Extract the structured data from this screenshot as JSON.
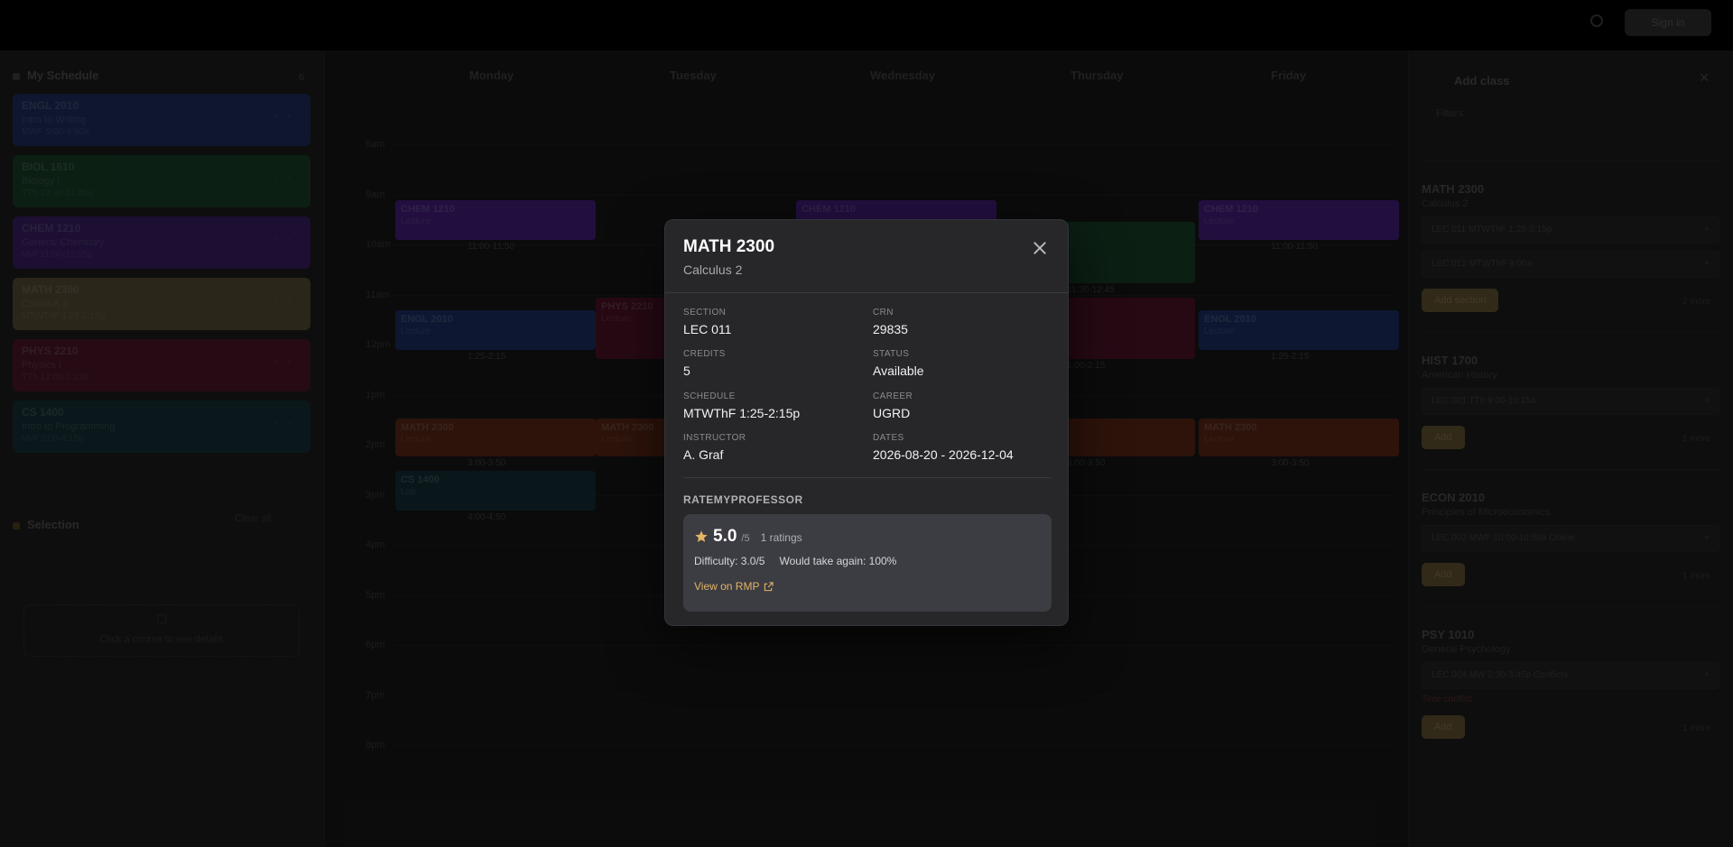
{
  "topbar": {
    "action_label": "Sign in"
  },
  "left_panel": {
    "heading": "My Schedule",
    "count": "6",
    "courses": [
      {
        "code": "ENGL 2010",
        "title": "Intro to Writing",
        "meta": "MWF 9:00-9:50a",
        "color": "#1f3a8a"
      },
      {
        "code": "BIOL 1610",
        "title": "Biology I",
        "meta": "TTh 10:30-11:45a",
        "color": "#14532d"
      },
      {
        "code": "CHEM 1210",
        "title": "General Chemistry",
        "meta": "MW 11:00-12:15p",
        "color": "#4c1d95"
      },
      {
        "code": "MATH 2300",
        "title": "Calculus 2",
        "meta": "MTWThF 1:25-2:15p",
        "color": "#7a6a44"
      },
      {
        "code": "PHYS 2210",
        "title": "Physics I",
        "meta": "TTh 12:00-1:15p",
        "color": "#6b1032"
      },
      {
        "code": "CS 1400",
        "title": "Intro to Programming",
        "meta": "MW 3:00-4:15p",
        "color": "#0f3b45"
      }
    ],
    "link": "Clear all",
    "selection_heading": "Selection",
    "selection_hint": "Click a course to see details"
  },
  "calendar": {
    "days": [
      "Monday",
      "Tuesday",
      "Wednesday",
      "Thursday",
      "Friday"
    ],
    "times": [
      "8am",
      "9am",
      "10am",
      "11am",
      "12pm",
      "1pm",
      "2pm",
      "3pm",
      "4pm",
      "5pm",
      "6pm",
      "7pm",
      "8pm"
    ],
    "blocks": [
      {
        "code": "CHEM 1210",
        "sub": "Lecture",
        "time": "11:00-11:50",
        "color": "#5b21b6"
      },
      {
        "code": "CHEM 1210",
        "sub": "Lecture",
        "time": "11:00-11:50",
        "color": "#5b21b6"
      },
      {
        "code": "CHEM 1210",
        "sub": "Lecture",
        "time": "11:00-11:50",
        "color": "#5b21b6"
      },
      {
        "code": "BIOL 1610",
        "sub": "Lecture",
        "time": "11:30-12:45",
        "color": "#14532d"
      },
      {
        "code": "ENGL 2010",
        "sub": "Lecture",
        "time": "1:25-2:15",
        "color": "#1e3a8a"
      },
      {
        "code": "PHYS 2210",
        "sub": "Lecture",
        "time": "1:00-2:15",
        "color": "#6b1032"
      },
      {
        "code": "PHYS 2210",
        "sub": "Lecture",
        "time": "1:00-2:15",
        "color": "#6b1032"
      },
      {
        "code": "ENGL 2010",
        "sub": "Lecture",
        "time": "1:25-2:15",
        "color": "#1e3a8a"
      },
      {
        "code": "MATH 2300",
        "sub": "Lecture",
        "time": "3:00-3:50",
        "color": "#7c2d12"
      },
      {
        "code": "MATH 2300",
        "sub": "Lecture",
        "time": "3:00-3:50",
        "color": "#7c2d12"
      },
      {
        "code": "MATH 2300",
        "sub": "Lecture",
        "time": "3:00-3:50",
        "color": "#7c2d12"
      },
      {
        "code": "MATH 2300",
        "sub": "Lecture",
        "time": "3:00-3:50",
        "color": "#7c2d12"
      },
      {
        "code": "CS 1400",
        "sub": "Lab",
        "time": "4:00-4:50",
        "color": "#0f3b45"
      }
    ]
  },
  "right_panel": {
    "title": "Add class",
    "filter": "Filters",
    "cards": [
      {
        "code": "MATH 2300",
        "title": "Calculus 2",
        "rows": [
          "LEC 011 MTWThF 1:25-2:15p",
          "LEC 012 MTWThF 9:00a"
        ],
        "warn": "",
        "add": "Add section",
        "more": "2 more"
      },
      {
        "code": "HIST 1700",
        "title": "American History",
        "rows": [
          "LEC 001 TTh 9:00-10:15a"
        ],
        "warn": "",
        "add": "Add",
        "more": "1 more"
      },
      {
        "code": "ECON 2010",
        "title": "Principles of Microeconomics",
        "rows": [
          "LEC 002 MWF 10:00-10:50a Online"
        ],
        "warn": "",
        "add": "Add",
        "more": "1 more"
      },
      {
        "code": "PSY 1010",
        "title": "General Psychology",
        "rows": [
          "LEC 004 MW 2:30-3:45p Conflicts"
        ],
        "warn": "Time conflict",
        "add": "Add",
        "more": "1 more"
      }
    ]
  },
  "modal": {
    "code": "MATH 2300",
    "title": "Calculus 2",
    "fields": [
      {
        "label": "SECTION",
        "value": "LEC 011"
      },
      {
        "label": "CRN",
        "value": "29835"
      },
      {
        "label": "CREDITS",
        "value": "5"
      },
      {
        "label": "STATUS",
        "value": "Available"
      },
      {
        "label": "SCHEDULE",
        "value": "MTWThF 1:25-2:15p"
      },
      {
        "label": "CAREER",
        "value": "UGRD"
      },
      {
        "label": "INSTRUCTOR",
        "value": "A. Graf"
      },
      {
        "label": "DATES",
        "value": "2026-08-20 - 2026-12-04"
      }
    ],
    "rmp": {
      "heading": "RATEMYPROFESSOR",
      "score": "5.0",
      "out_of": "/5",
      "ratings": "1 ratings",
      "difficulty": "Difficulty: 3.0/5",
      "take_again": "Would take again: 100%",
      "link": "View on RMP"
    },
    "colors": {
      "accent": "#e2b563",
      "star": "#e2b563",
      "surface": "#27272a",
      "card": "#3c3c43"
    }
  }
}
